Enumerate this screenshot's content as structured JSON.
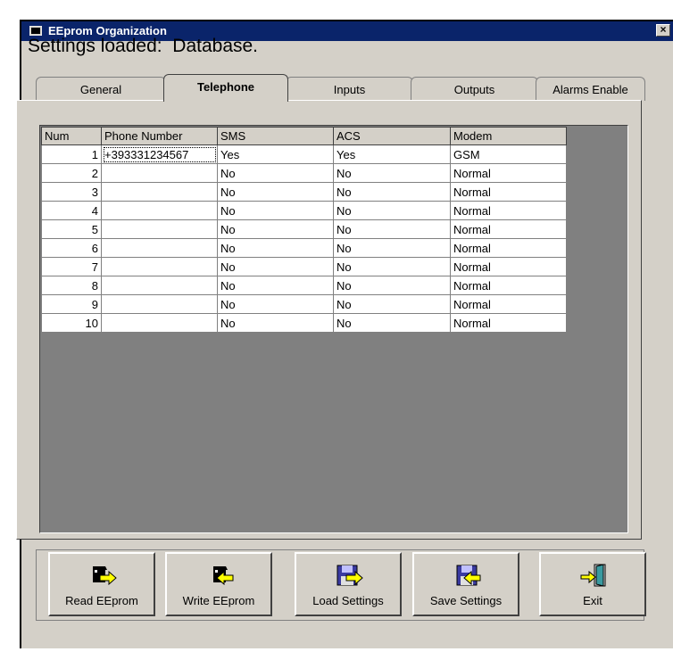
{
  "window": {
    "title": "EEprom Organization",
    "close_glyph": "×"
  },
  "status_text": "Settings loaded:  Database.",
  "tabs": [
    {
      "label": "General",
      "active": false
    },
    {
      "label": "Telephone",
      "active": true
    },
    {
      "label": "Inputs",
      "active": false
    },
    {
      "label": "Outputs",
      "active": false
    },
    {
      "label": "Alarms Enable",
      "active": false
    }
  ],
  "table": {
    "headers": [
      "Num",
      "Phone Number",
      "SMS",
      "ACS",
      "Modem"
    ],
    "rows": [
      [
        "1",
        "+393331234567",
        "Yes",
        "Yes",
        "GSM"
      ],
      [
        "2",
        "",
        "No",
        "No",
        "Normal"
      ],
      [
        "3",
        "",
        "No",
        "No",
        "Normal"
      ],
      [
        "4",
        "",
        "No",
        "No",
        "Normal"
      ],
      [
        "5",
        "",
        "No",
        "No",
        "Normal"
      ],
      [
        "6",
        "",
        "No",
        "No",
        "Normal"
      ],
      [
        "7",
        "",
        "No",
        "No",
        "Normal"
      ],
      [
        "8",
        "",
        "No",
        "No",
        "Normal"
      ],
      [
        "9",
        "",
        "No",
        "No",
        "Normal"
      ],
      [
        "10",
        "",
        "No",
        "No",
        "Normal"
      ]
    ]
  },
  "buttons": {
    "read": {
      "label": "Read EEprom",
      "icon": "chip-read-icon"
    },
    "write": {
      "label": "Write EEprom",
      "icon": "chip-write-icon"
    },
    "load": {
      "label": "Load Settings",
      "icon": "floppy-load-icon"
    },
    "save": {
      "label": "Save Settings",
      "icon": "floppy-save-icon"
    },
    "exit": {
      "label": "Exit",
      "icon": "exit-door-icon"
    }
  },
  "colors": {
    "titlebar": "#0a246a",
    "face": "#d4d0c8",
    "grid_bg": "#808080",
    "arrow": "#ffff00"
  }
}
